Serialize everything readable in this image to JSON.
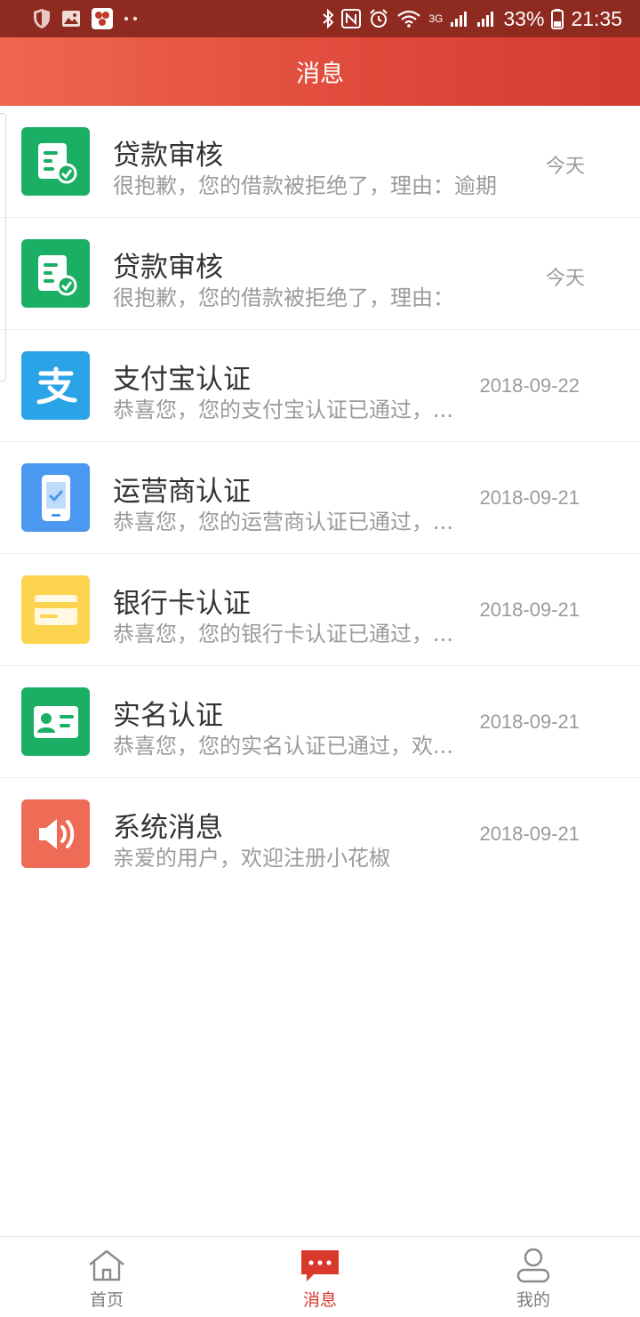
{
  "status_bar": {
    "network": "3G",
    "battery": "33%",
    "time": "21:35"
  },
  "header": {
    "title": "消息"
  },
  "messages": [
    {
      "title": "贷款审核",
      "desc": "很抱歉，您的借款被拒绝了，理由：逾期",
      "date": "今天",
      "icon": "loan-review-icon",
      "color": "#1aaf65"
    },
    {
      "title": "贷款审核",
      "desc": "很抱歉，您的借款被拒绝了，理由：",
      "date": "今天",
      "icon": "loan-review-icon",
      "color": "#1aaf65"
    },
    {
      "title": "支付宝认证",
      "desc": "恭喜您，您的支付宝认证已通过，...",
      "date": "2018-09-22",
      "icon": "alipay-icon",
      "color": "#2aa4e6"
    },
    {
      "title": "运营商认证",
      "desc": "恭喜您，您的运营商认证已通过，...",
      "date": "2018-09-21",
      "icon": "phone-carrier-icon",
      "color": "#4a98f0"
    },
    {
      "title": "银行卡认证",
      "desc": "恭喜您，您的银行卡认证已通过，...",
      "date": "2018-09-21",
      "icon": "bank-card-icon",
      "color": "#fcd44e"
    },
    {
      "title": "实名认证",
      "desc": "恭喜您，您的实名认证已通过，欢...",
      "date": "2018-09-21",
      "icon": "id-card-icon",
      "color": "#1aaf65"
    },
    {
      "title": "系统消息",
      "desc": "亲爱的用户，欢迎注册小花椒",
      "date": "2018-09-21",
      "icon": "speaker-icon",
      "color": "#ee6b56"
    }
  ],
  "bottom_nav": [
    {
      "label": "首页",
      "icon": "home-icon",
      "active": false
    },
    {
      "label": "消息",
      "icon": "message-icon",
      "active": true
    },
    {
      "label": "我的",
      "icon": "profile-icon",
      "active": false
    }
  ],
  "colors": {
    "header_start": "#ee6650",
    "header_end": "#d33c31",
    "status_bar": "#8f2a20",
    "active_tab": "#d9382b"
  }
}
